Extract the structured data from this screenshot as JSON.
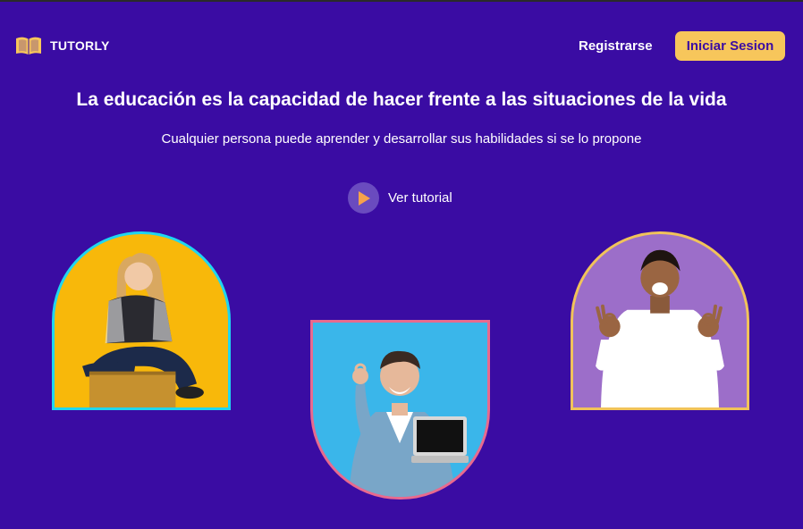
{
  "brand": {
    "name": "TUTORLY",
    "icon": "open-book-icon",
    "icon_color": "#f7c65b"
  },
  "nav": {
    "register_label": "Registrarse",
    "login_label": "Iniciar Sesion"
  },
  "hero": {
    "title": "La educación es la capacidad de hacer frente a las situaciones de la vida",
    "subtitle": "Cualquier persona puede aprender y desarrollar sus habilidades si se lo propone",
    "tutorial_label": "Ver tutorial",
    "tutorial_icon": "play-icon"
  },
  "photos": [
    {
      "subject": "woman-with-laptop",
      "border_color": "#1fd6f0",
      "background_color": "#f8b80a"
    },
    {
      "subject": "man-holding-laptop",
      "border_color": "#e86a8e",
      "background_color": "#3ab6ea"
    },
    {
      "subject": "man-ok-gesture",
      "border_color": "#f1c35a",
      "background_color": "#9c6ec9"
    }
  ],
  "colors": {
    "background": "#3a0ca3",
    "accent": "#f7c65b",
    "text": "#ffffff"
  }
}
